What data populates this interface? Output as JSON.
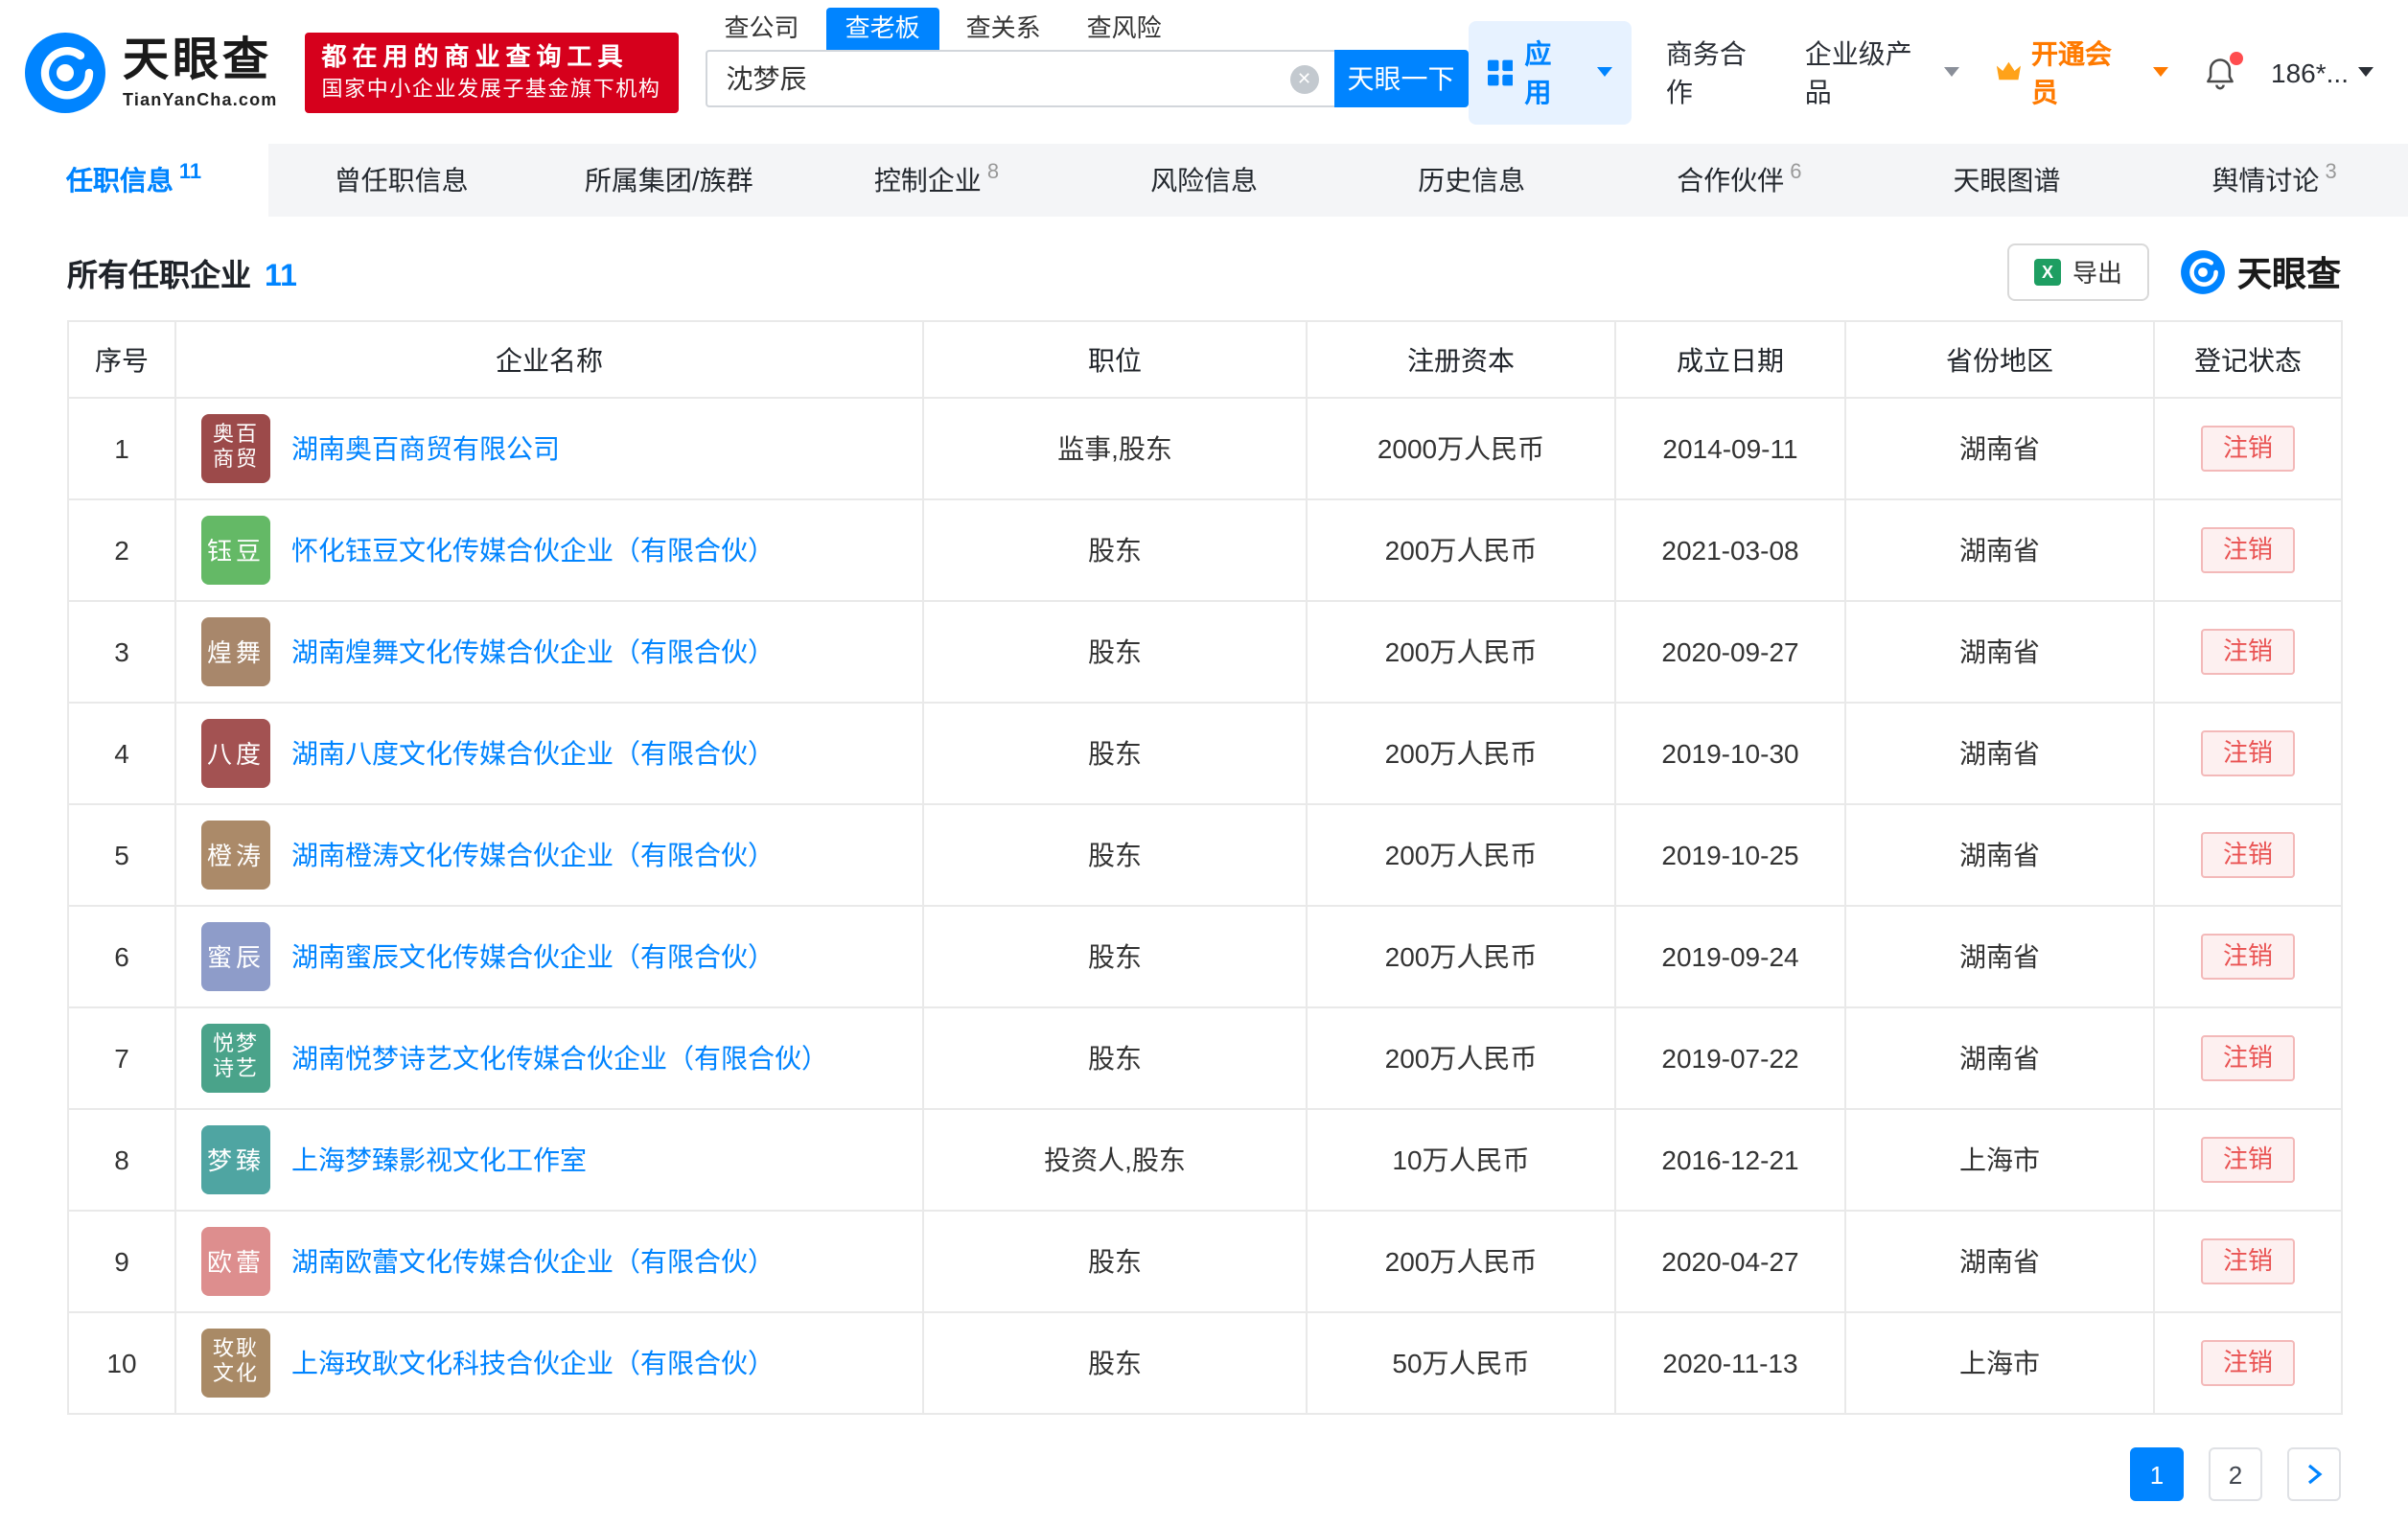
{
  "colors": {
    "brand_blue": "#0084ff",
    "vip_orange": "#ff7a00",
    "slogan_red": "#d6001c",
    "status_red": "#e95252"
  },
  "header": {
    "logo": {
      "title": "天眼查",
      "subtitle": "TianYanCha.com"
    },
    "slogan": {
      "line1": "都在用的商业查询工具",
      "line2": "国家中小企业发展子基金旗下机构"
    },
    "search": {
      "tabs": [
        {
          "label": "查公司",
          "active": false
        },
        {
          "label": "查老板",
          "active": true
        },
        {
          "label": "查关系",
          "active": false
        },
        {
          "label": "查风险",
          "active": false
        }
      ],
      "value": "沈梦辰",
      "button": "天眼一下"
    },
    "menu": {
      "apps": "应用",
      "cooperation": "商务合作",
      "enterprise": "企业级产品",
      "vip": "开通会员",
      "user": "186*..."
    }
  },
  "nav": {
    "tabs": [
      {
        "label": "任职信息",
        "count": "11",
        "active": true
      },
      {
        "label": "曾任职信息",
        "count": "",
        "active": false
      },
      {
        "label": "所属集团/族群",
        "count": "",
        "active": false
      },
      {
        "label": "控制企业",
        "count": "8",
        "active": false
      },
      {
        "label": "风险信息",
        "count": "",
        "active": false
      },
      {
        "label": "历史信息",
        "count": "",
        "active": false
      },
      {
        "label": "合作伙伴",
        "count": "6",
        "active": false
      },
      {
        "label": "天眼图谱",
        "count": "",
        "active": false
      },
      {
        "label": "舆情讨论",
        "count": "3",
        "active": false
      }
    ]
  },
  "section": {
    "title": "所有任职企业",
    "count": "11",
    "export_label": "导出",
    "brand": "天眼查"
  },
  "table": {
    "headers": [
      "序号",
      "企业名称",
      "职位",
      "注册资本",
      "成立日期",
      "省份地区",
      "登记状态"
    ],
    "rows": [
      {
        "no": "1",
        "icon_text": "奥百商贸",
        "icon_color": "#9c4a4a",
        "name": "湖南奥百商贸有限公司",
        "position": "监事,股东",
        "capital": "2000万人民币",
        "date": "2014-09-11",
        "region": "湖南省",
        "status": "注销"
      },
      {
        "no": "2",
        "icon_text": "钰豆",
        "icon_color": "#64b966",
        "name": "怀化钰豆文化传媒合伙企业（有限合伙）",
        "position": "股东",
        "capital": "200万人民币",
        "date": "2021-03-08",
        "region": "湖南省",
        "status": "注销"
      },
      {
        "no": "3",
        "icon_text": "煌舞",
        "icon_color": "#a8876b",
        "name": "湖南煌舞文化传媒合伙企业（有限合伙）",
        "position": "股东",
        "capital": "200万人民币",
        "date": "2020-09-27",
        "region": "湖南省",
        "status": "注销"
      },
      {
        "no": "4",
        "icon_text": "八度",
        "icon_color": "#a35252",
        "name": "湖南八度文化传媒合伙企业（有限合伙）",
        "position": "股东",
        "capital": "200万人民币",
        "date": "2019-10-30",
        "region": "湖南省",
        "status": "注销"
      },
      {
        "no": "5",
        "icon_text": "橙涛",
        "icon_color": "#ab8a69",
        "name": "湖南橙涛文化传媒合伙企业（有限合伙）",
        "position": "股东",
        "capital": "200万人民币",
        "date": "2019-10-25",
        "region": "湖南省",
        "status": "注销"
      },
      {
        "no": "6",
        "icon_text": "蜜辰",
        "icon_color": "#8e9cc9",
        "name": "湖南蜜辰文化传媒合伙企业（有限合伙）",
        "position": "股东",
        "capital": "200万人民币",
        "date": "2019-09-24",
        "region": "湖南省",
        "status": "注销"
      },
      {
        "no": "7",
        "icon_text": "悦梦诗艺",
        "icon_color": "#4aa38a",
        "name": "湖南悦梦诗艺文化传媒合伙企业（有限合伙）",
        "position": "股东",
        "capital": "200万人民币",
        "date": "2019-07-22",
        "region": "湖南省",
        "status": "注销"
      },
      {
        "no": "8",
        "icon_text": "梦臻",
        "icon_color": "#4fa5a2",
        "name": "上海梦臻影视文化工作室",
        "position": "投资人,股东",
        "capital": "10万人民币",
        "date": "2016-12-21",
        "region": "上海市",
        "status": "注销"
      },
      {
        "no": "9",
        "icon_text": "欧蕾",
        "icon_color": "#dd8e8e",
        "name": "湖南欧蕾文化传媒合伙企业（有限合伙）",
        "position": "股东",
        "capital": "200万人民币",
        "date": "2020-04-27",
        "region": "湖南省",
        "status": "注销"
      },
      {
        "no": "10",
        "icon_text": "玫耿文化",
        "icon_color": "#a98a66",
        "name": "上海玫耿文化科技合伙企业（有限合伙）",
        "position": "股东",
        "capital": "50万人民币",
        "date": "2020-11-13",
        "region": "上海市",
        "status": "注销"
      }
    ]
  },
  "pagination": {
    "pages": [
      "1",
      "2"
    ],
    "current": "1"
  }
}
